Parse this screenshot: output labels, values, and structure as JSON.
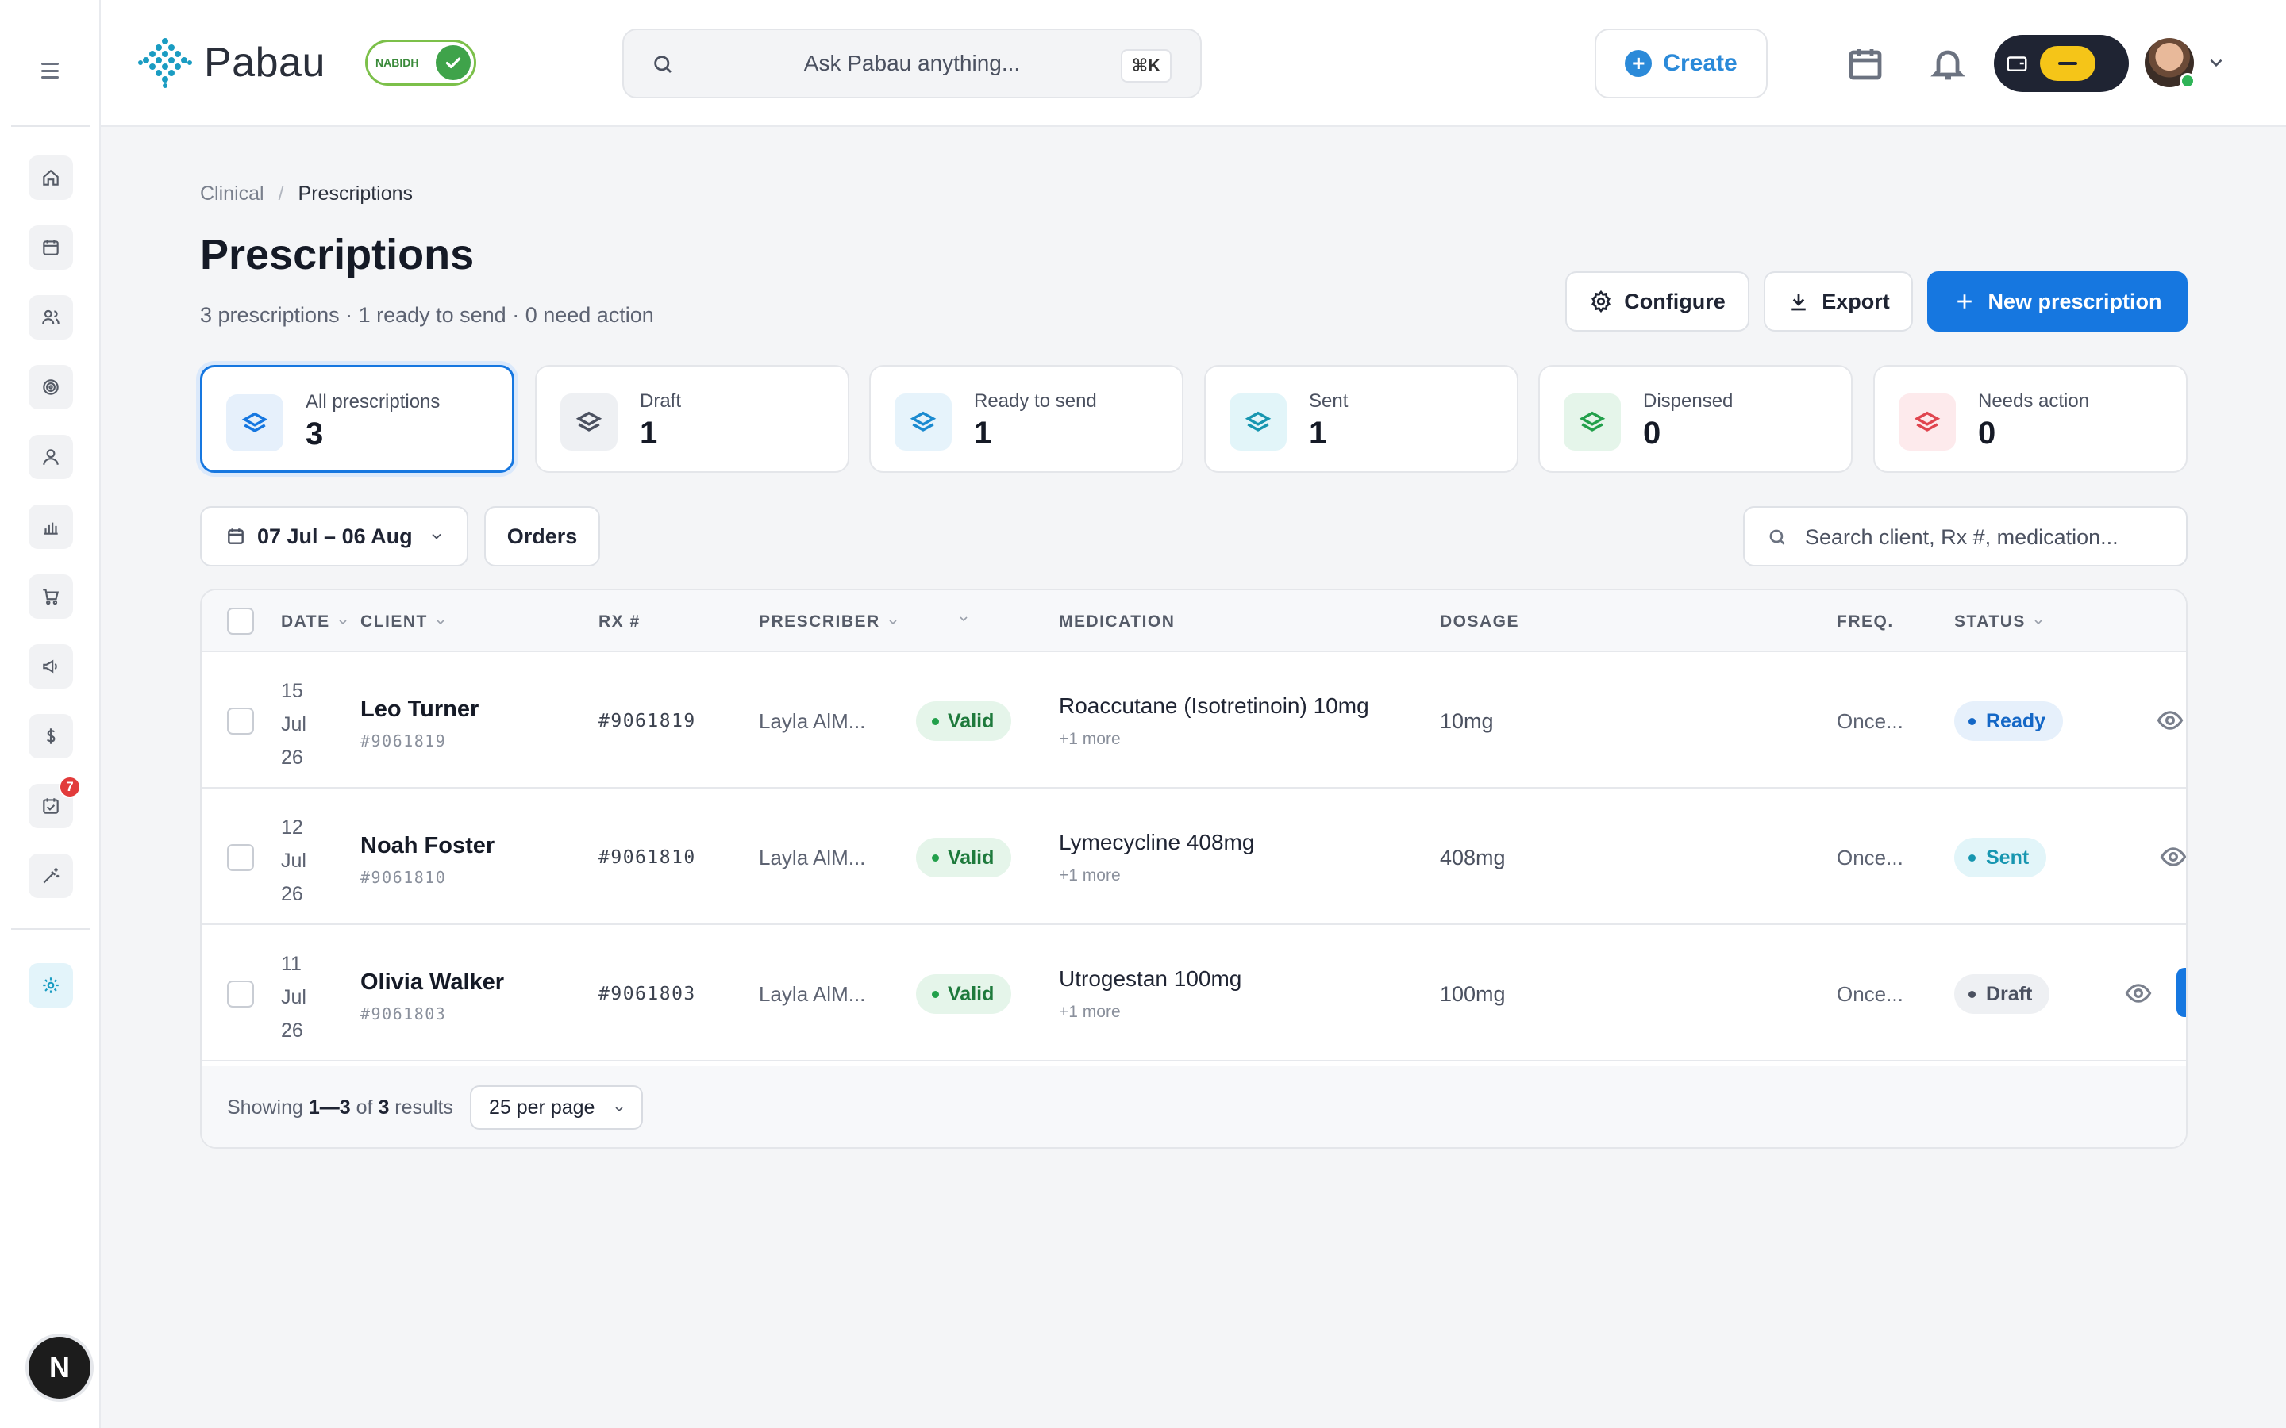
{
  "brand": {
    "name": "Pabau",
    "badge_text": "NABIDH",
    "accent": "#1a9cc2"
  },
  "topbar": {
    "search_placeholder": "Ask Pabau anything...",
    "search_shortcut": "⌘K",
    "create_label": "Create",
    "icons": [
      "calendar-icon",
      "bell-icon",
      "wallet-icon",
      "avatar"
    ]
  },
  "sidebar": {
    "items": [
      {
        "name": "home-icon"
      },
      {
        "name": "calendar-icon"
      },
      {
        "name": "clients-icon"
      },
      {
        "name": "target-icon"
      },
      {
        "name": "user-icon"
      },
      {
        "name": "reports-icon"
      },
      {
        "name": "cart-icon"
      },
      {
        "name": "megaphone-icon"
      },
      {
        "name": "dollar-icon"
      },
      {
        "name": "tasks-icon",
        "badge": "7"
      },
      {
        "name": "magic-wand-icon"
      },
      {
        "name": "settings-icon"
      }
    ],
    "bottom_avatar": "N"
  },
  "breadcrumb": {
    "parent": "Clinical",
    "separator": "/",
    "current": "Prescriptions"
  },
  "page": {
    "title": "Prescriptions",
    "subtitle": "3 prescriptions · 1 ready to send · 0 need action"
  },
  "actions": {
    "configure": "Configure",
    "export": "Export",
    "new_prescription": "New prescription"
  },
  "stats": [
    {
      "label": "All prescriptions",
      "value": "3",
      "color": "#1677e0",
      "bg": "#e6f0fb"
    },
    {
      "label": "Draft",
      "value": "1",
      "color": "#4b5160",
      "bg": "#eef0f3"
    },
    {
      "label": "Ready to send",
      "value": "1",
      "color": "#1a8ad0",
      "bg": "#e6f3fb"
    },
    {
      "label": "Sent",
      "value": "1",
      "color": "#1796b0",
      "bg": "#e2f5f9"
    },
    {
      "label": "Dispensed",
      "value": "0",
      "color": "#22a04b",
      "bg": "#e5f5ea"
    },
    {
      "label": "Needs action",
      "value": "0",
      "color": "#e0454f",
      "bg": "#fdeaec"
    }
  ],
  "filters": {
    "date_range": "07 Jul – 06 Aug",
    "orders": "Orders",
    "search_placeholder": "Search client, Rx #, medication..."
  },
  "table": {
    "columns": {
      "date": "DATE",
      "client": "CLIENT",
      "rx": "RX #",
      "prescriber": "PRESCRIBER",
      "medication": "MEDICATION",
      "dosage": "DOSAGE",
      "freq": "FREQ.",
      "status": "STATUS"
    },
    "rows": [
      {
        "day": "15",
        "month": "Jul",
        "year": "26",
        "client": "Leo Turner",
        "client_id": "#9061819",
        "rx": "#9061819",
        "prescriber": "Layla AlM...",
        "validity": "Valid",
        "medication": "Roaccutane (Isotretinoin) 10mg",
        "more": "+1 more",
        "dosage": "10mg",
        "freq": "Once...",
        "status": "Ready"
      },
      {
        "day": "12",
        "month": "Jul",
        "year": "26",
        "client": "Noah Foster",
        "client_id": "#9061810",
        "rx": "#9061810",
        "prescriber": "Layla AlM...",
        "validity": "Valid",
        "medication": "Lymecycline 408mg",
        "more": "+1 more",
        "dosage": "408mg",
        "freq": "Once...",
        "status": "Sent"
      },
      {
        "day": "11",
        "month": "Jul",
        "year": "26",
        "client": "Olivia Walker",
        "client_id": "#9061803",
        "rx": "#9061803",
        "prescriber": "Layla AlM...",
        "validity": "Valid",
        "medication": "Utrogestan 100mg",
        "more": "+1 more",
        "dosage": "100mg",
        "freq": "Once...",
        "status": "Draft"
      }
    ]
  },
  "footer": {
    "showing_prefix": "Showing",
    "range": "1—3",
    "of": "of",
    "total": "3",
    "results": "results",
    "per_page": "25 per page"
  }
}
